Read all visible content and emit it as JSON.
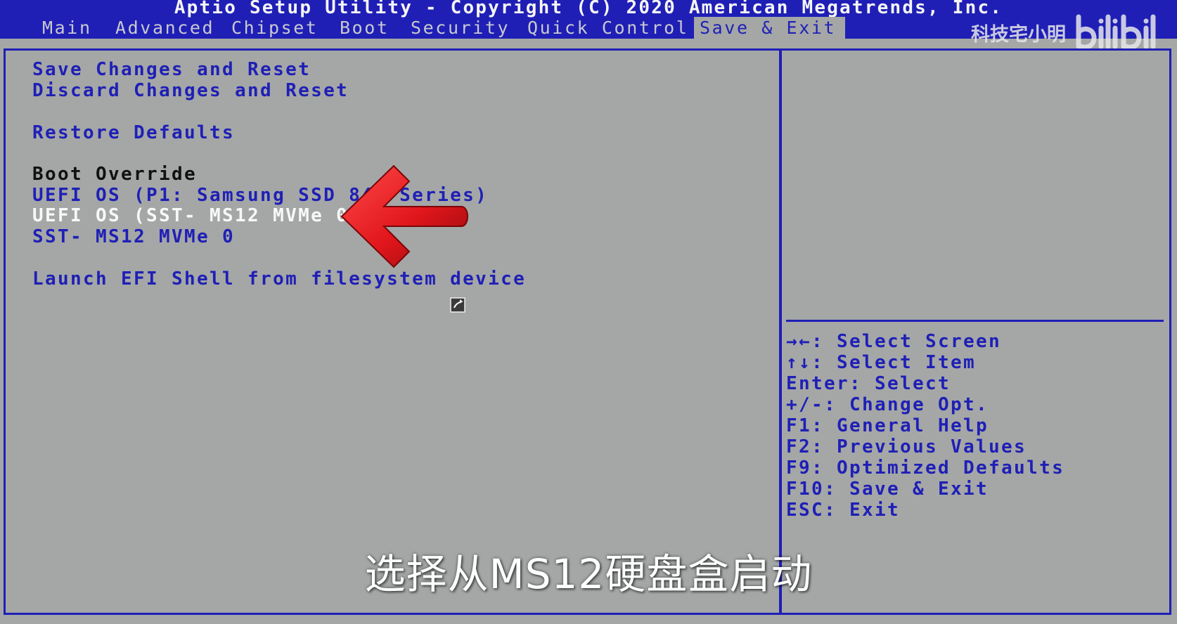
{
  "window": {
    "title": "Aptio Setup Utility - Copyright (C) 2020 American Megatrends, Inc."
  },
  "tabs": [
    {
      "label": "Main"
    },
    {
      "label": "Advanced"
    },
    {
      "label": "Chipset"
    },
    {
      "label": "Boot"
    },
    {
      "label": "Security"
    },
    {
      "label": "Quick Control"
    },
    {
      "label": "Save & Exit",
      "active": true
    }
  ],
  "menu": {
    "save_reset": "Save Changes and Reset",
    "discard_reset": "Discard Changes and Reset",
    "restore_defaults": "Restore Defaults",
    "boot_override_header": "Boot Override",
    "boot_options": [
      "UEFI OS (P1: Samsung SSD 840 Series)",
      "UEFI OS (SST- MS12 MVMe 0)",
      "SST- MS12 MVMe 0"
    ],
    "launch_efi_shell": "Launch EFI Shell from filesystem device",
    "selected_index": 1
  },
  "help_keys": [
    "→←: Select Screen",
    "↑↓: Select Item",
    "Enter: Select",
    "+/-: Change Opt.",
    "F1: General Help",
    "F2: Previous Values",
    "F9: Optimized Defaults",
    "F10: Save & Exit",
    "ESC: Exit"
  ],
  "overlay": {
    "watermark_text": "科技宅小明",
    "watermark_logo": "bilibili",
    "subtitle": "选择从MS12硬盘盒启动",
    "arrow_color": "#e0161b",
    "cursor_icon": "keyboard-layout-cursor-icon"
  },
  "colors": {
    "bios_blue": "#1f1fb6",
    "bios_gray": "#a4a7a6",
    "selected_text": "#f8f8f8",
    "header_text": "#111111"
  }
}
